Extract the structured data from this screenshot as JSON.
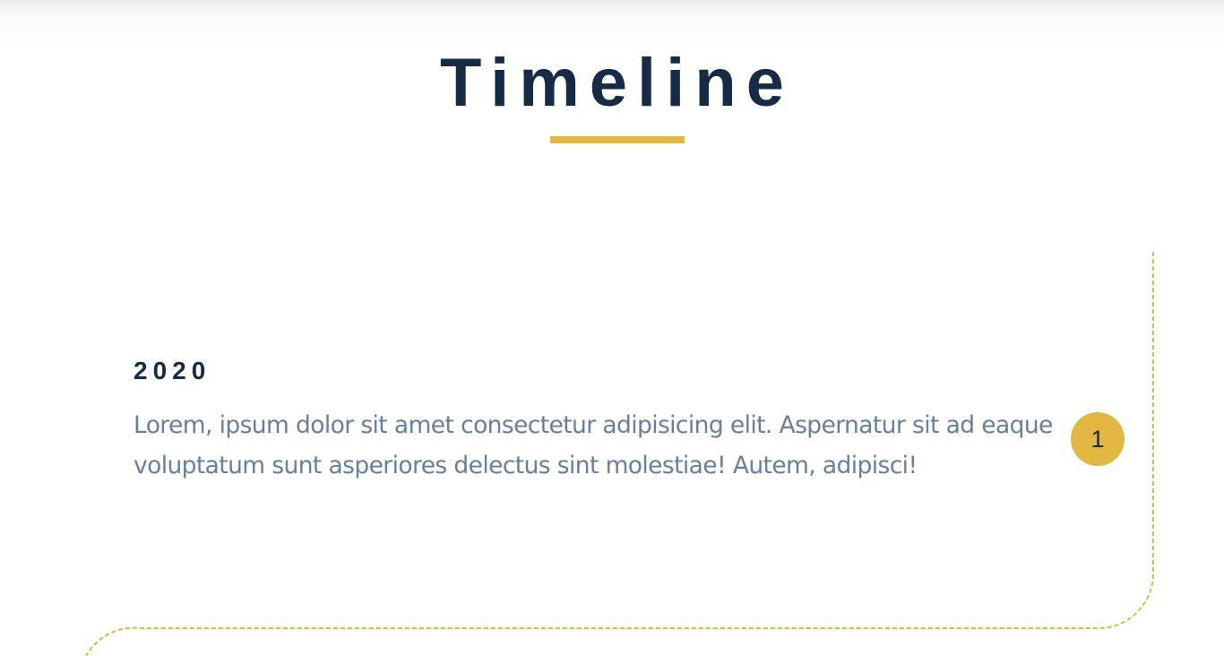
{
  "page": {
    "title": "Timeline"
  },
  "timeline": {
    "accent_color": "#e2b742",
    "heading_color": "#172a46",
    "text_color": "#66809e",
    "entries": [
      {
        "year": "2020",
        "text": "Lorem, ipsum dolor sit amet consectetur adipisicing elit. Aspernatur sit ad eaque voluptatum sunt asperiores delectus sint molestiae! Autem, adipisci!",
        "badge": "1"
      }
    ]
  }
}
